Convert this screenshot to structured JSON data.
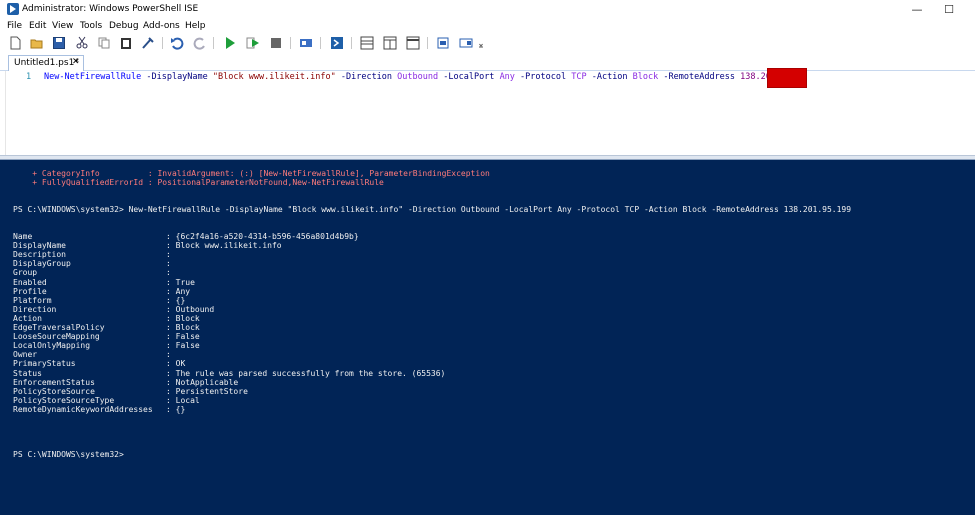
{
  "window": {
    "title": "Administrator: Windows PowerShell ISE",
    "minimize": "—",
    "maximize": "☐"
  },
  "menu": [
    "File",
    "Edit",
    "View",
    "Tools",
    "Debug",
    "Add-ons",
    "Help"
  ],
  "toolbar_icons": [
    "new-icon",
    "open-icon",
    "save-icon",
    "cut-icon",
    "copy-icon",
    "paste-icon",
    "clear-icon",
    "undo-icon",
    "redo-icon",
    "run-icon",
    "run-selection-icon",
    "stop-icon",
    "remote-icon",
    "powershell-icon",
    "pane-top-icon",
    "pane-right-icon",
    "pane-max-icon",
    "commands-icon",
    "addon-icon"
  ],
  "tab": {
    "label": "Untitled1.ps1*",
    "close": "✕"
  },
  "script": {
    "line_number": "1",
    "tokens": {
      "cmd": "New-NetFirewallRule",
      "p1": "-DisplayName",
      "v1": "\"Block www.ilikeit.info\"",
      "p2": "-Direction",
      "v2": "Outbound",
      "p3": "-LocalPort",
      "v3": "Any",
      "p4": "-Protocol",
      "v4": "TCP",
      "p5": "-Action",
      "v5": "Block",
      "p6": "-RemoteAddress",
      "v6": "138.201"
    }
  },
  "console": {
    "error_lines": [
      "    + CategoryInfo          : InvalidArgument: (:) [New-NetFirewallRule], ParameterBindingException",
      "    + FullyQualifiedErrorId : PositionalParameterNotFound,New-NetFirewallRule"
    ],
    "prompt_command": "PS C:\\WINDOWS\\system32> New-NetFirewallRule -DisplayName \"Block www.ilikeit.info\" -Direction Outbound -LocalPort Any -Protocol TCP -Action Block -RemoteAddress 138.201.95.199",
    "properties": [
      {
        "key": "Name",
        "value": ": {6c2f4a16-a520-4314-b596-456a801d4b9b}"
      },
      {
        "key": "DisplayName",
        "value": ": Block www.ilikeit.info"
      },
      {
        "key": "Description",
        "value": ":"
      },
      {
        "key": "DisplayGroup",
        "value": ":"
      },
      {
        "key": "Group",
        "value": ":"
      },
      {
        "key": "Enabled",
        "value": ": True"
      },
      {
        "key": "Profile",
        "value": ": Any"
      },
      {
        "key": "Platform",
        "value": ": {}"
      },
      {
        "key": "Direction",
        "value": ": Outbound"
      },
      {
        "key": "Action",
        "value": ": Block"
      },
      {
        "key": "EdgeTraversalPolicy",
        "value": ": Block"
      },
      {
        "key": "LooseSourceMapping",
        "value": ": False"
      },
      {
        "key": "LocalOnlyMapping",
        "value": ": False"
      },
      {
        "key": "Owner",
        "value": ":"
      },
      {
        "key": "PrimaryStatus",
        "value": ": OK"
      },
      {
        "key": "Status",
        "value": ": The rule was parsed successfully from the store. (65536)"
      },
      {
        "key": "EnforcementStatus",
        "value": ": NotApplicable"
      },
      {
        "key": "PolicyStoreSource",
        "value": ": PersistentStore"
      },
      {
        "key": "PolicyStoreSourceType",
        "value": ": Local"
      },
      {
        "key": "RemoteDynamicKeywordAddresses",
        "value": ": {}"
      }
    ],
    "final_prompt": "PS C:\\WINDOWS\\system32>"
  },
  "colors": {
    "console_bg": "#012456",
    "error_text": "#ff7b7b",
    "redaction": "#d40000"
  }
}
